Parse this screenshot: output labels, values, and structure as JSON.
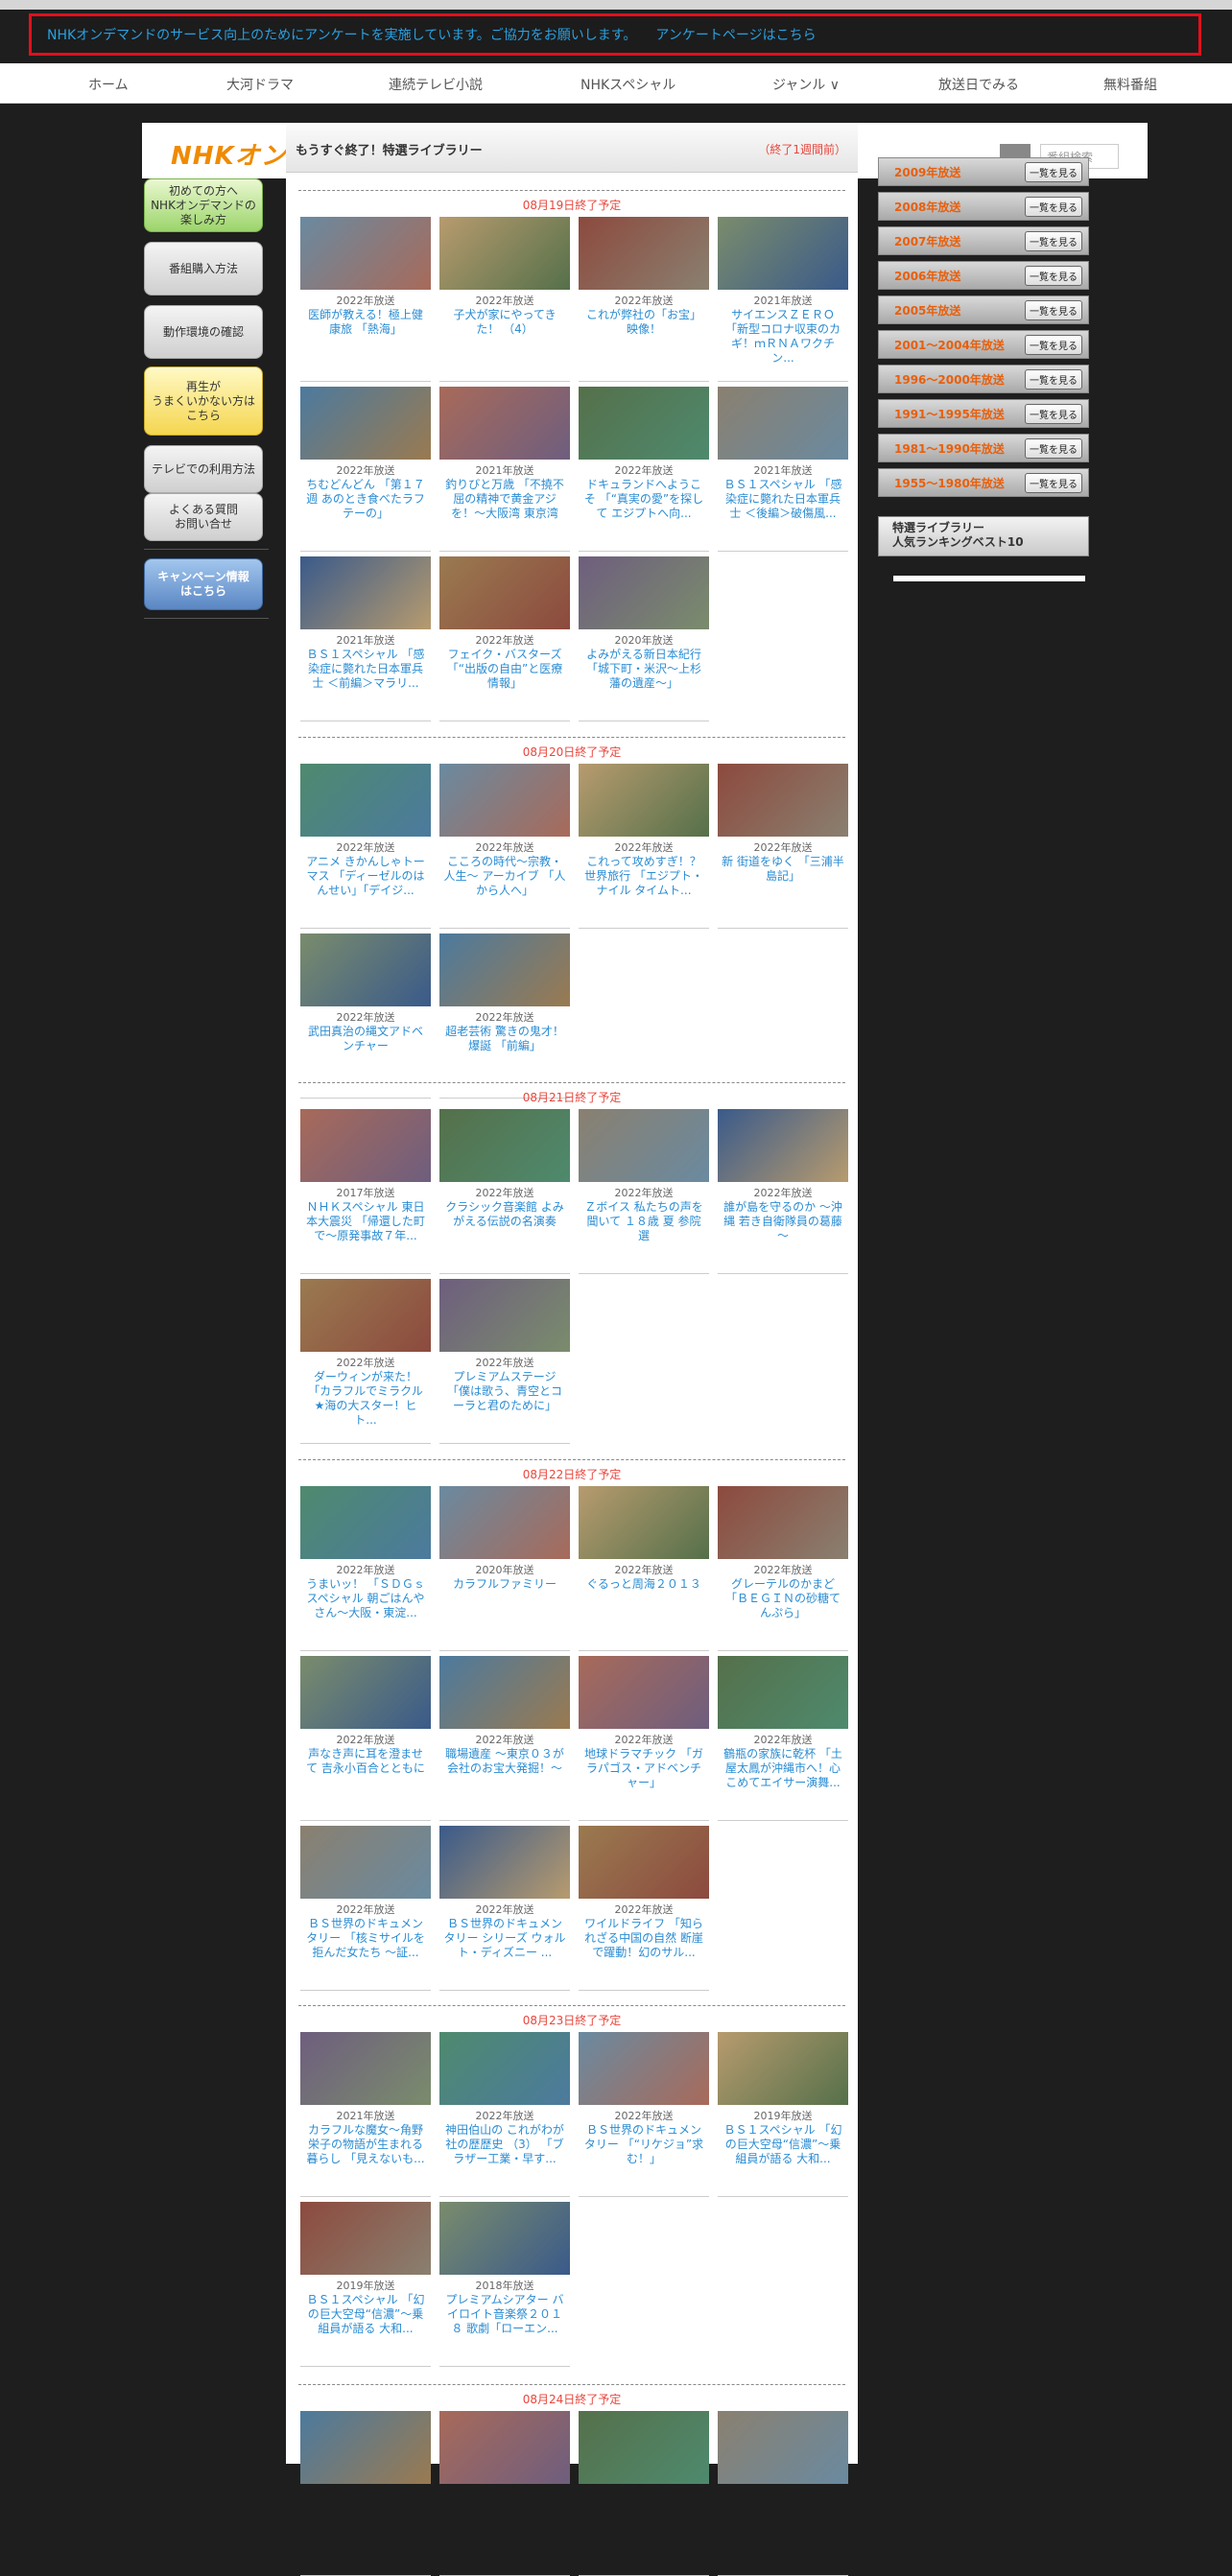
{
  "survey": {
    "message": "NHKオンデマンドのサービス向上のためにアンケートを実施しています。ご協力をお願いします。",
    "link": "アンケートページはこちら"
  },
  "nav": [
    {
      "label": "ホーム"
    },
    {
      "label": "大河ドラマ"
    },
    {
      "label": "連続テレビ小説"
    },
    {
      "label": "NHKスペシャル"
    },
    {
      "label": "ジャンル ∨"
    },
    {
      "label": "放送日でみる"
    },
    {
      "label": "無料番組"
    }
  ],
  "header": {
    "logo": "NHKオン",
    "search_placeholder": "番組検索"
  },
  "sidebar": {
    "btn1": "初めての方へ\nNHKオンデマンドの\n楽しみ方",
    "btn2": "番組購入方法",
    "btn3": "動作環境の確認",
    "btn4": "再生が\nうまくいかない方は\nこちら",
    "btn5": "テレビでの利用方法",
    "btn6": "よくある質問\nお問い合せ",
    "btn7": "キャンペーン情報\nはこちら"
  },
  "main": {
    "title": "もうすぐ終了！特選ライブラリー",
    "subtitle": "（終了1週間前）"
  },
  "sections": [
    {
      "label": "08月19日終了予定",
      "items": [
        {
          "year": "2022年放送",
          "title": "医師が教える！極上健康旅 「熱海」"
        },
        {
          "year": "2022年放送",
          "title": "子犬が家にやってきた！ （4）"
        },
        {
          "year": "2022年放送",
          "title": "これが弊社の「お宝」映像！"
        },
        {
          "year": "2021年放送",
          "title": "サイエンスＺＥＲＯ 「新型コロナ収束のカギ！ｍＲＮＡワクチン..."
        },
        {
          "year": "2022年放送",
          "title": "ちむどんどん 「第１７週 あのとき食べたラフテーの」"
        },
        {
          "year": "2021年放送",
          "title": "釣りびと万歳 「不撓不屈の精神で黄金アジを！～大阪湾 東京湾"
        },
        {
          "year": "2022年放送",
          "title": "ドキュランドへようこそ 「“真実の愛”を探して エジプトへ向..."
        },
        {
          "year": "2021年放送",
          "title": "ＢＳ１スペシャル 「感染症に斃れた日本軍兵士 ＜後編＞破傷風..."
        },
        {
          "year": "2021年放送",
          "title": "ＢＳ１スペシャル 「感染症に斃れた日本軍兵士 ＜前編＞マラリ..."
        },
        {
          "year": "2022年放送",
          "title": "フェイク・バスターズ 「“出版の自由”と医療情報」"
        },
        {
          "year": "2020年放送",
          "title": "よみがえる新日本紀行 「城下町・米沢～上杉藩の遺産～」"
        }
      ]
    },
    {
      "label": "08月20日終了予定",
      "items": [
        {
          "year": "2022年放送",
          "title": "アニメ きかんしゃトーマス 「ディーゼルのはんせい」「デイジ..."
        },
        {
          "year": "2022年放送",
          "title": "こころの時代～宗教・人生～ アーカイブ 「人から人へ」"
        },
        {
          "year": "2022年放送",
          "title": "これって攻めすぎ！？世界旅行 「エジプト・ナイル タイムト..."
        },
        {
          "year": "2022年放送",
          "title": "新 街道をゆく 「三浦半島記」"
        },
        {
          "year": "2022年放送",
          "title": "武田真治の縄文アドベンチャー"
        },
        {
          "year": "2022年放送",
          "title": "超老芸術 驚きの鬼才！爆誕 「前編」"
        }
      ]
    },
    {
      "label": "08月21日終了予定",
      "items": [
        {
          "year": "2017年放送",
          "title": "ＮＨＫスペシャル 東日本大震災 「帰還した町で～原発事故７年..."
        },
        {
          "year": "2022年放送",
          "title": "クラシック音楽館 よみがえる伝説の名演奏"
        },
        {
          "year": "2022年放送",
          "title": "Ｚボイス 私たちの声を聞いて １８歳 夏 参院選"
        },
        {
          "year": "2022年放送",
          "title": "誰が島を守るのか ～沖縄 若き自衛隊員の葛藤～"
        },
        {
          "year": "2022年放送",
          "title": "ダーウィンが来た！ 「カラフルでミラクル★海の大スター！ヒト..."
        },
        {
          "year": "2022年放送",
          "title": "プレミアムステージ 「僕は歌う、青空とコーラと君のために」"
        }
      ]
    },
    {
      "label": "08月22日終了予定",
      "items": [
        {
          "year": "2022年放送",
          "title": "うまいッ！ 「ＳＤＧｓスペシャル 朝ごはんやさん～大阪・東淀..."
        },
        {
          "year": "2020年放送",
          "title": "カラフルファミリー"
        },
        {
          "year": "2022年放送",
          "title": "ぐるっと周海２０１３"
        },
        {
          "year": "2022年放送",
          "title": "グレーテルのかまど 「ＢＥＧＩＮの砂糖てんぷら」"
        },
        {
          "year": "2022年放送",
          "title": "声なき声に耳を澄ませて 吉永小百合とともに"
        },
        {
          "year": "2022年放送",
          "title": "職場遺産 ～東京０３が会社のお宝大発掘！～"
        },
        {
          "year": "2022年放送",
          "title": "地球ドラマチック 「ガラパゴス・アドベンチャー」"
        },
        {
          "year": "2022年放送",
          "title": "鶴瓶の家族に乾杯 「土屋太鳳が沖縄市へ！心こめてエイサー演舞..."
        },
        {
          "year": "2022年放送",
          "title": "ＢＳ世界のドキュメンタリー 「核ミサイルを拒んだ女たち ～証..."
        },
        {
          "year": "2022年放送",
          "title": "ＢＳ世界のドキュメンタリー シリーズ ウォルト・ディズニー ..."
        },
        {
          "year": "2022年放送",
          "title": "ワイルドライフ 「知られざる中国の自然 断崖で躍動！幻のサル..."
        }
      ]
    },
    {
      "label": "08月23日終了予定",
      "items": [
        {
          "year": "2021年放送",
          "title": "カラフルな魔女～角野栄子の物語が生まれる暮らし 「見えないも..."
        },
        {
          "year": "2022年放送",
          "title": "神田伯山の これがわが社の歴歴史 （3） 「ブラザー工業・早す..."
        },
        {
          "year": "2022年放送",
          "title": "ＢＳ世界のドキュメンタリー 「“リケジョ”求む！」"
        },
        {
          "year": "2019年放送",
          "title": "ＢＳ１スペシャル 「幻の巨大空母“信濃”～乗組員が語る 大和..."
        },
        {
          "year": "2019年放送",
          "title": "ＢＳ１スペシャル 「幻の巨大空母“信濃”～乗組員が語る 大和..."
        },
        {
          "year": "2018年放送",
          "title": "プレミアムシアター バイロイト音楽祭２０１８ 歌劇「ローエン..."
        }
      ]
    },
    {
      "label": "08月24日終了予定",
      "items": [
        {
          "year": "",
          "title": ""
        },
        {
          "year": "",
          "title": ""
        },
        {
          "year": "",
          "title": ""
        },
        {
          "year": "",
          "title": ""
        }
      ]
    }
  ],
  "years": [
    {
      "label": "2009年放送"
    },
    {
      "label": "2008年放送"
    },
    {
      "label": "2007年放送"
    },
    {
      "label": "2006年放送"
    },
    {
      "label": "2005年放送"
    },
    {
      "label": "2001～2004年放送"
    },
    {
      "label": "1996～2000年放送"
    },
    {
      "label": "1991～1995年放送"
    },
    {
      "label": "1981～1990年放送"
    },
    {
      "label": "1955～1980年放送"
    }
  ],
  "year_button_label": "一覧を見る",
  "ranking": {
    "line1": "特選ライブラリー",
    "line2": "人気ランキングベスト10"
  }
}
